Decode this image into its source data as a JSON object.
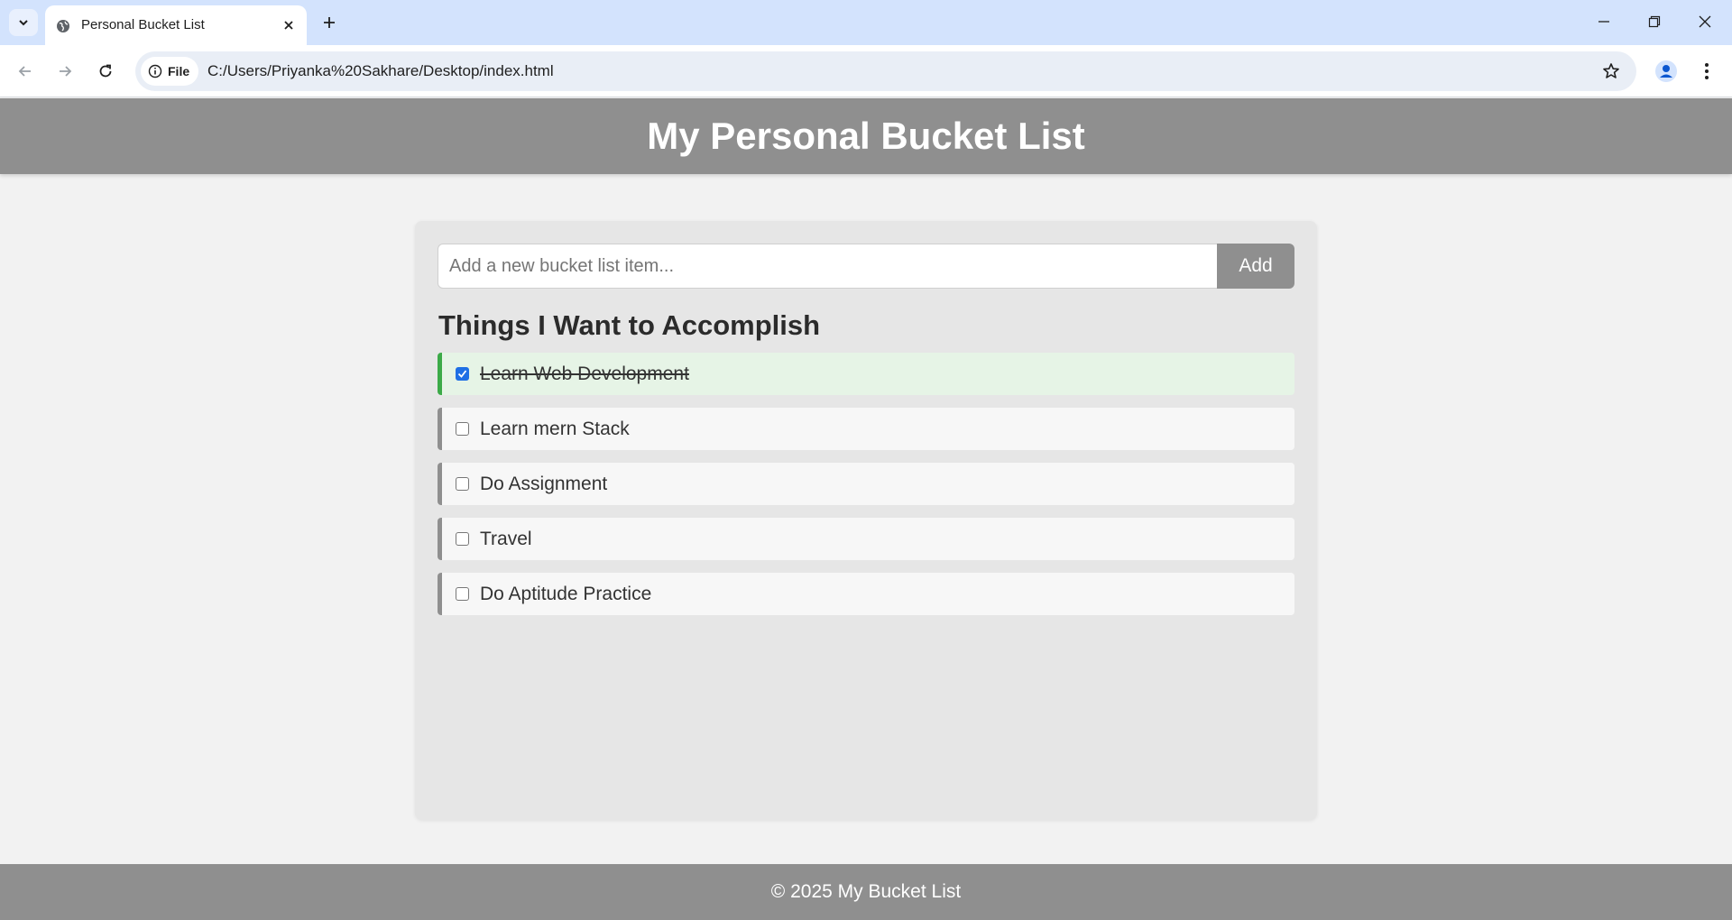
{
  "browser": {
    "tab_title": "Personal Bucket List",
    "chip_label": "File",
    "url": "C:/Users/Priyanka%20Sakhare/Desktop/index.html"
  },
  "header": {
    "title": "My Personal Bucket List"
  },
  "form": {
    "placeholder": "Add a new bucket list item...",
    "value": "",
    "add_label": "Add"
  },
  "list": {
    "heading": "Things I Want to Accomplish",
    "items": [
      {
        "text": "Learn Web Development",
        "done": true
      },
      {
        "text": "Learn mern Stack",
        "done": false
      },
      {
        "text": "Do Assignment",
        "done": false
      },
      {
        "text": "Travel",
        "done": false
      },
      {
        "text": "Do Aptitude Practice",
        "done": false
      }
    ]
  },
  "footer": {
    "text": "© 2025 My Bucket List"
  },
  "colors": {
    "header_bg": "#8f8f8f",
    "done_accent": "#3caa48",
    "pending_accent": "#8f8f8f",
    "checkbox_checked": "#1f6fe5"
  }
}
